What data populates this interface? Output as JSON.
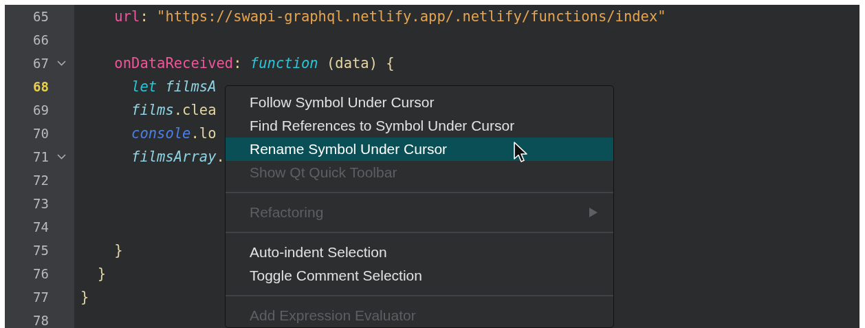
{
  "editor": {
    "lines": [
      {
        "number": "65",
        "current": false,
        "fold": false,
        "tokens": [
          {
            "kind": "key",
            "text": "    url"
          },
          {
            "kind": "punct",
            "text": ": "
          },
          {
            "kind": "string",
            "text": "\"https://swapi-graphql.netlify.app/.netlify/functions/index\""
          }
        ]
      },
      {
        "number": "66",
        "current": false,
        "fold": false
      },
      {
        "number": "67",
        "current": false,
        "fold": true,
        "tokens": [
          {
            "kind": "key",
            "text": "    onDataReceived"
          },
          {
            "kind": "punct",
            "text": ": "
          },
          {
            "kind": "keyword",
            "text": "function"
          },
          {
            "kind": "punct",
            "text": " (data) {"
          }
        ]
      },
      {
        "number": "68",
        "current": true,
        "fold": false,
        "tokens": [
          {
            "kind": "keyword",
            "text": "      let"
          },
          {
            "kind": "variable",
            "text": " filmsA"
          }
        ]
      },
      {
        "number": "69",
        "current": false,
        "fold": false,
        "tokens": [
          {
            "kind": "variable",
            "text": "      films"
          },
          {
            "kind": "punct",
            "text": ".clea"
          }
        ]
      },
      {
        "number": "70",
        "current": false,
        "fold": false,
        "tokens": [
          {
            "kind": "builtin",
            "text": "      console"
          },
          {
            "kind": "punct",
            "text": ".lo"
          }
        ]
      },
      {
        "number": "71",
        "current": false,
        "fold": true,
        "tokens": [
          {
            "kind": "variable",
            "text": "      filmsArray"
          },
          {
            "kind": "punct",
            "text": "."
          }
        ]
      },
      {
        "number": "72",
        "current": false,
        "fold": false
      },
      {
        "number": "73",
        "current": false,
        "fold": false
      },
      {
        "number": "74",
        "current": false,
        "fold": false
      },
      {
        "number": "75",
        "current": false,
        "fold": false,
        "tokens": [
          {
            "kind": "punct",
            "text": "    }"
          }
        ]
      },
      {
        "number": "76",
        "current": false,
        "fold": false,
        "tokens": [
          {
            "kind": "punct",
            "text": "  }"
          }
        ]
      },
      {
        "number": "77",
        "current": false,
        "fold": false,
        "tokens": [
          {
            "kind": "punct",
            "text": "}"
          }
        ]
      },
      {
        "number": "78",
        "current": false,
        "fold": false
      }
    ]
  },
  "context_menu": {
    "items": [
      {
        "kind": "item",
        "label": "Follow Symbol Under Cursor",
        "disabled": false,
        "selected": false,
        "submenu": false
      },
      {
        "kind": "item",
        "label": "Find References to Symbol Under Cursor",
        "disabled": false,
        "selected": false,
        "submenu": false
      },
      {
        "kind": "item",
        "label": "Rename Symbol Under Cursor",
        "disabled": false,
        "selected": true,
        "submenu": false
      },
      {
        "kind": "item",
        "label": "Show Qt Quick Toolbar",
        "disabled": true,
        "selected": false,
        "submenu": false
      },
      {
        "kind": "separator"
      },
      {
        "kind": "item",
        "label": "Refactoring",
        "disabled": true,
        "selected": false,
        "submenu": true
      },
      {
        "kind": "separator"
      },
      {
        "kind": "item",
        "label": "Auto-indent Selection",
        "disabled": false,
        "selected": false,
        "submenu": false
      },
      {
        "kind": "item",
        "label": "Toggle Comment Selection",
        "disabled": false,
        "selected": false,
        "submenu": false
      },
      {
        "kind": "separator"
      },
      {
        "kind": "item",
        "label": "Add Expression Evaluator",
        "disabled": true,
        "selected": false,
        "submenu": false
      }
    ]
  }
}
